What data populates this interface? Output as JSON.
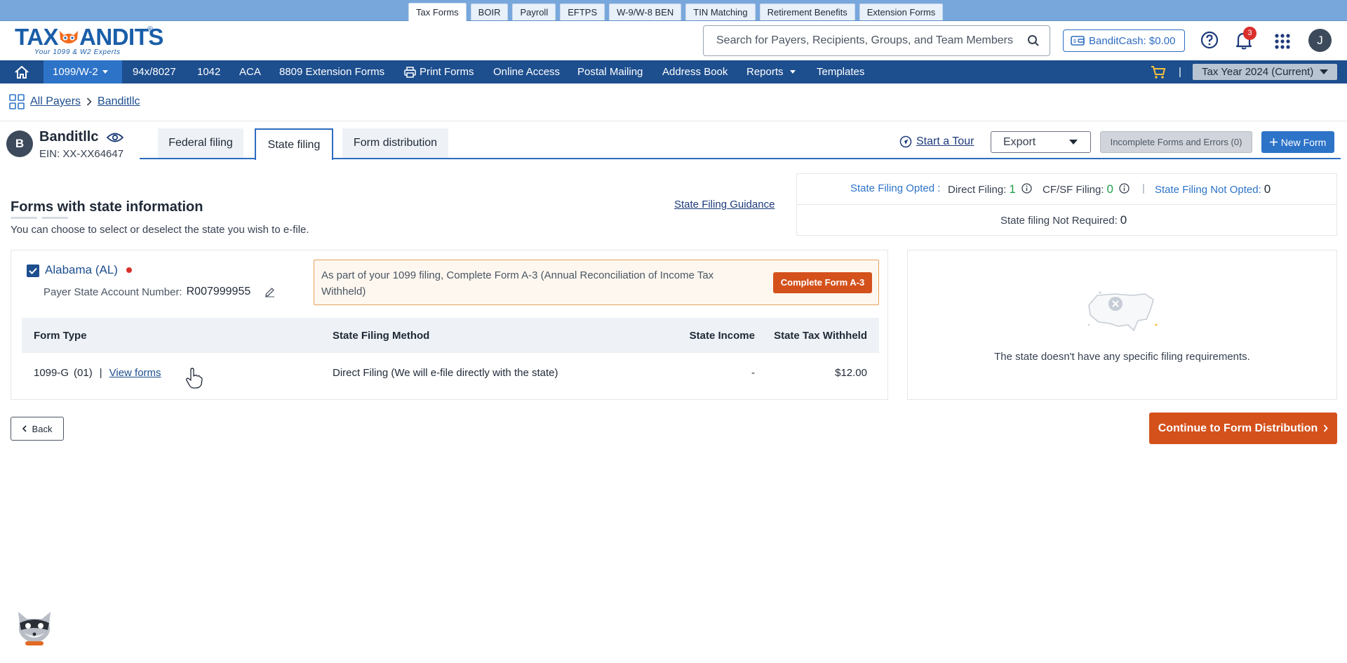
{
  "top_tabs": [
    "Tax Forms",
    "BOIR",
    "Payroll",
    "EFTPS",
    "W-9/W-8 BEN",
    "TIN Matching",
    "Retirement Benefits",
    "Extension Forms"
  ],
  "header": {
    "logo_text_left": "TAX",
    "logo_text_right": "ANDITS",
    "logo_reg": "®",
    "logo_tagline": "Your 1099 & W2 Experts",
    "search_placeholder": "Search for Payers, Recipients, Groups, and Team Members",
    "bandit_cash": "BanditCash: $0.00",
    "notification_count": "3",
    "user_initial": "J"
  },
  "nav": {
    "active": "1099/W-2",
    "items": [
      "94x/8027",
      "1042",
      "ACA",
      "8809 Extension Forms",
      "Print Forms",
      "Online Access",
      "Postal Mailing",
      "Address Book",
      "Reports",
      "Templates"
    ],
    "tax_year": "Tax Year 2024 (Current)",
    "divider": "|"
  },
  "breadcrumb": {
    "all_payers": "All Payers",
    "current": "Banditllc"
  },
  "payer": {
    "initial": "B",
    "name": "Banditllc",
    "ein": "EIN: XX-XX64647"
  },
  "filing_tabs": [
    "Federal filing",
    "State filing",
    "Form distribution"
  ],
  "actions": {
    "start_tour": "Start a Tour",
    "export": "Export",
    "incomplete": "Incomplete Forms and Errors (0)",
    "new_form": "New Form"
  },
  "section": {
    "title": "Forms with state information",
    "subtitle": "You can choose to select or deselect the state you wish to e-file.",
    "guidance": "State Filing Guidance"
  },
  "summary": {
    "opted_label": "State Filing Opted :",
    "direct_label": "Direct Filing:",
    "direct_value": "1",
    "cfsf_label": "CF/SF Filing:",
    "cfsf_value": "0",
    "divider": "|",
    "not_opted_label": "State Filing Not Opted:",
    "not_opted_value": "0",
    "not_required_label": "State filing Not Required:",
    "not_required_value": "0"
  },
  "state": {
    "name": "Alabama (AL)",
    "account_label": "Payer State Account Number:",
    "account_value": "R007999955",
    "notice": "As part of your 1099 filing, Complete Form A-3 (Annual Reconciliation of Income Tax Withheld)",
    "notice_button": "Complete Form A-3",
    "columns": [
      "Form Type",
      "State Filing Method",
      "State Income",
      "State Tax Withheld"
    ],
    "row": {
      "form_type": "1099-G",
      "form_count": "(01)",
      "sep": "|",
      "view_forms": "View forms",
      "method": "Direct Filing (We will e-file directly with the state)",
      "income": "-",
      "withheld": "$12.00"
    }
  },
  "empty_panel": {
    "message": "The state doesn't have any specific filing requirements."
  },
  "buttons": {
    "back": "Back",
    "continue": "Continue to Form Distribution"
  },
  "colors": {
    "brand_blue": "#1d4e8e",
    "accent_blue": "#2d73c8",
    "orange": "#d4511c",
    "green": "#22a04a"
  }
}
